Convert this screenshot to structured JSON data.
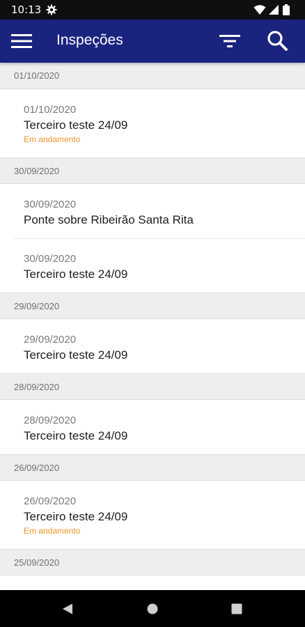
{
  "status_bar": {
    "time": "10:13",
    "icons": [
      "gear-icon",
      "wifi-icon",
      "signal-icon",
      "battery-icon"
    ]
  },
  "app_bar": {
    "title": "Inspeções",
    "icons": [
      "menu-icon",
      "filter-icon",
      "search-icon"
    ],
    "color": "#1a237e"
  },
  "colors": {
    "status_in_progress": "#f0932b",
    "group_header_bg": "#eeeef0"
  },
  "groups": [
    {
      "date": "01/10/2020",
      "items": [
        {
          "date": "01/10/2020",
          "title": "Terceiro teste 24/09",
          "status": "Em andamento"
        }
      ]
    },
    {
      "date": "30/09/2020",
      "items": [
        {
          "date": "30/09/2020",
          "title": "Ponte sobre Ribeirão Santa Rita",
          "status": ""
        },
        {
          "date": "30/09/2020",
          "title": "Terceiro teste 24/09",
          "status": ""
        }
      ]
    },
    {
      "date": "29/09/2020",
      "items": [
        {
          "date": "29/09/2020",
          "title": "Terceiro teste 24/09",
          "status": ""
        }
      ]
    },
    {
      "date": "28/09/2020",
      "items": [
        {
          "date": "28/09/2020",
          "title": "Terceiro teste 24/09",
          "status": ""
        }
      ]
    },
    {
      "date": "26/09/2020",
      "items": [
        {
          "date": "26/09/2020",
          "title": "Terceiro teste 24/09",
          "status": "Em andamento"
        }
      ]
    },
    {
      "date": "25/09/2020",
      "items": []
    }
  ],
  "nav_bar": {
    "icons": [
      "back-icon",
      "home-icon",
      "recents-icon"
    ]
  }
}
